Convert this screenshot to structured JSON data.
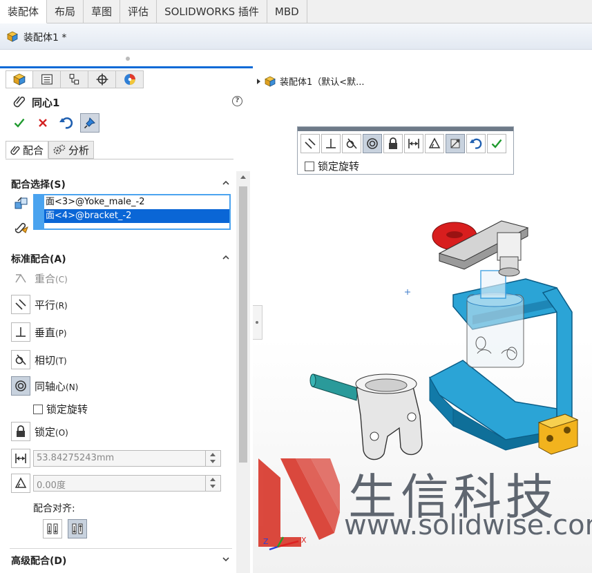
{
  "tabs": [
    "装配体",
    "布局",
    "草图",
    "评估",
    "SOLIDWORKS 插件",
    "MBD"
  ],
  "document": {
    "title": "装配体1 *"
  },
  "property_manager": {
    "title": "同心1",
    "help": "?",
    "subtabs": [
      "配合",
      "分析"
    ],
    "mate_selections": {
      "heading": "配合选择(S)",
      "items": [
        "面<3>@Yoke_male_-2",
        "面<4>@bracket_-2"
      ]
    },
    "standard_mates": {
      "heading": "标准配合(A)",
      "coincident": "重合",
      "coincident_acc": "(C)",
      "parallel": "平行",
      "parallel_acc": "(R)",
      "perpendicular": "垂直",
      "perpendicular_acc": "(P)",
      "tangent": "相切",
      "tangent_acc": "(T)",
      "concentric": "同轴心",
      "concentric_acc": "(N)",
      "lock_rotation": "锁定旋转",
      "lock": "锁定",
      "lock_acc": "(O)",
      "distance_value": "53.84275243mm",
      "angle_value": "0.00度",
      "mate_alignment": "配合对齐:"
    },
    "advanced_mates": {
      "heading": "高级配合(D)"
    }
  },
  "graphics": {
    "tree_label": "装配体1（默认<默...",
    "popup_lock_rotation": "锁定旋转",
    "triad": {
      "x": "X",
      "z": "Z"
    }
  },
  "watermark": {
    "cn": "生信科技",
    "url": "www.solidwise.com"
  }
}
